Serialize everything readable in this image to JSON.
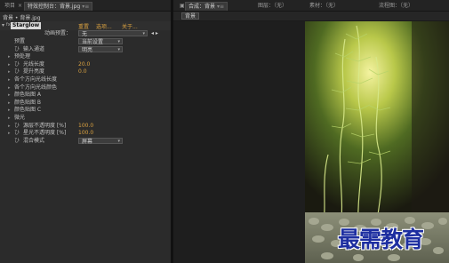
{
  "left_tabs": {
    "project": "项目",
    "effect_controls_prefix": "特效控制台：",
    "effect_controls_file": "背景.jpg"
  },
  "breadcrumb": "背景 • 背景.jpg",
  "effect": {
    "expand_glyph": "▾",
    "fx_glyph": "fx",
    "name": "Starglow",
    "reset": "重置",
    "options": "选项...",
    "about": "关于...",
    "preset_label": "动画预置：",
    "preset_value": "无"
  },
  "properties": [
    {
      "twirl": "",
      "stopwatch": "",
      "label": "预置",
      "indent": 1,
      "dropdown": "当前设置"
    },
    {
      "twirl": "",
      "stopwatch": "ひ",
      "label": "输入通道",
      "indent": 2,
      "dropdown": "明亮"
    },
    {
      "twirl": "▸",
      "stopwatch": "",
      "label": "预处理",
      "indent": 1
    },
    {
      "twirl": "▸",
      "stopwatch": "ひ",
      "label": "光线长度",
      "indent": 2,
      "value": "20.0"
    },
    {
      "twirl": "▸",
      "stopwatch": "ひ",
      "label": "提升亮度",
      "indent": 2,
      "value": "0.0"
    },
    {
      "twirl": "▸",
      "stopwatch": "",
      "label": "各个方向光线长度",
      "indent": 1
    },
    {
      "twirl": "▸",
      "stopwatch": "",
      "label": "各个方向光线颜色",
      "indent": 1
    },
    {
      "twirl": "▸",
      "stopwatch": "",
      "label": "颜色贴图 A",
      "indent": 1
    },
    {
      "twirl": "▸",
      "stopwatch": "",
      "label": "颜色贴图 B",
      "indent": 1
    },
    {
      "twirl": "▸",
      "stopwatch": "",
      "label": "颜色贴图 C",
      "indent": 1
    },
    {
      "twirl": "▸",
      "stopwatch": "",
      "label": "微光",
      "indent": 1
    },
    {
      "twirl": "▸",
      "stopwatch": "ひ",
      "label": "源层不透明度 [%]",
      "indent": 2,
      "value": "100.0"
    },
    {
      "twirl": "▸",
      "stopwatch": "ひ",
      "label": "星光不透明度 [%]",
      "indent": 2,
      "value": "100.0"
    },
    {
      "twirl": "",
      "stopwatch": "ひ",
      "label": "混合模式",
      "indent": 2,
      "dropdown": "屏幕"
    }
  ],
  "right_tabs": {
    "composition": "合成：背景",
    "layer": "图层：（无）",
    "footage": "素材：（无）",
    "flowchart": "流程图：（无）"
  },
  "viewer_chip": "背景",
  "watermark": "最需教育",
  "colors": {
    "accent": "#d8a040",
    "panel": "#2b2b2b",
    "watermark": "#1d2ea0"
  }
}
